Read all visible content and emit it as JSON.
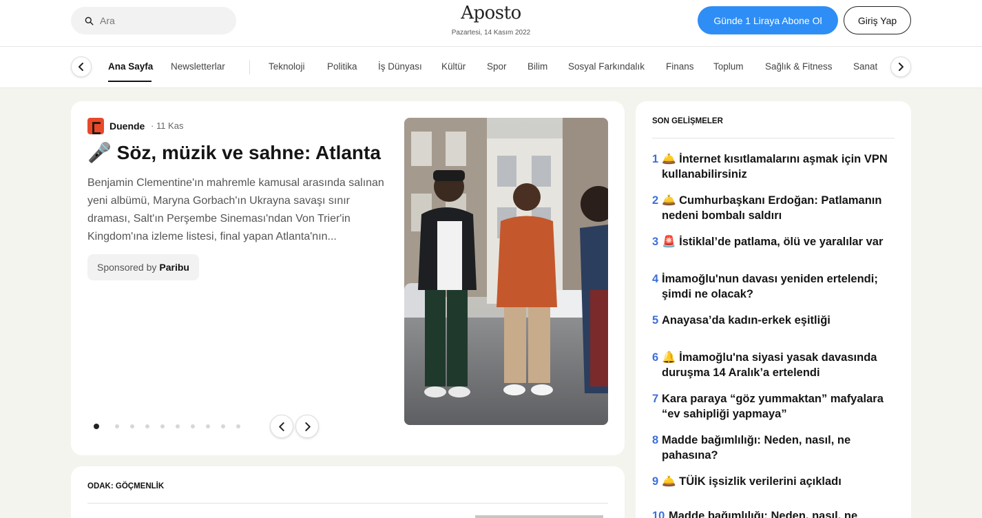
{
  "header": {
    "search_placeholder": "Ara",
    "logo": "Aposto",
    "date": "Pazartesi, 14 Kasım 2022",
    "subscribe_label": "Günde 1 Liraya Abone Ol",
    "login_label": "Giriş Yap",
    "accent_color": "#2f8ef5"
  },
  "nav": {
    "items": [
      "Ana Sayfa",
      "Newsletterlar",
      "Teknoloji",
      "Politika",
      "İş Dünyası",
      "Kültür",
      "Spor",
      "Bilim",
      "Sosyal Farkındalık",
      "Finans",
      "Toplum",
      "Sağlık & Fitness",
      "Sanat"
    ],
    "active": "Ana Sayfa"
  },
  "featured": {
    "source": "Duende",
    "date": "· 11 Kas",
    "title": "🎤 Söz, müzik ve sahne: Atlanta",
    "summary": "Benjamin Clementine'ın mahremle kamusal arasında salınan yeni albümü, Maryna Gorbach'ın Ukrayna savaşı sınır draması, Salt'ın Perşembe Sineması'ndan Von Trier'in Kingdom'ına izleme listesi, final yapan Atlanta'nın...",
    "sponsor_prefix": "Sponsored by",
    "sponsor_name": "Paribu",
    "slide_count": 10,
    "active_slide": 1
  },
  "focus": {
    "label": "ODAK: GÖÇMENLİK"
  },
  "sidebar": {
    "title": "SON GELİŞMELER",
    "items": [
      {
        "num": "1",
        "text": "🛎️ İnternet kısıtlamalarını aşmak için VPN kullanabilirsiniz"
      },
      {
        "num": "2",
        "text": "🛎️ Cumhurbaşkanı Erdoğan: Patlamanın nedeni bombalı saldırı"
      },
      {
        "num": "3",
        "text": "🚨 İstiklal’de patlama, ölü ve yaralılar var"
      },
      {
        "num": "4",
        "text": "İmamoğlu'nun davası yeniden ertelendi; şimdi ne olacak?"
      },
      {
        "num": "5",
        "text": "Anayasa’da kadın-erkek eşitliği"
      },
      {
        "num": "6",
        "text": "🔔 İmamoğlu'na siyasi yasak davasında duruşma 14 Aralık’a ertelendi"
      },
      {
        "num": "7",
        "text": "Kara paraya “göz yummaktan” mafyalara “ev sahipliği yapmaya”"
      },
      {
        "num": "8",
        "text": "Madde bağımlılığı: Neden, nasıl, ne pahasına?"
      },
      {
        "num": "9",
        "text": "🛎️ TÜİK işsizlik verilerini açıkladı"
      },
      {
        "num": "10",
        "text": "Madde bağımlılığı: Neden, nasıl, ne"
      }
    ]
  }
}
